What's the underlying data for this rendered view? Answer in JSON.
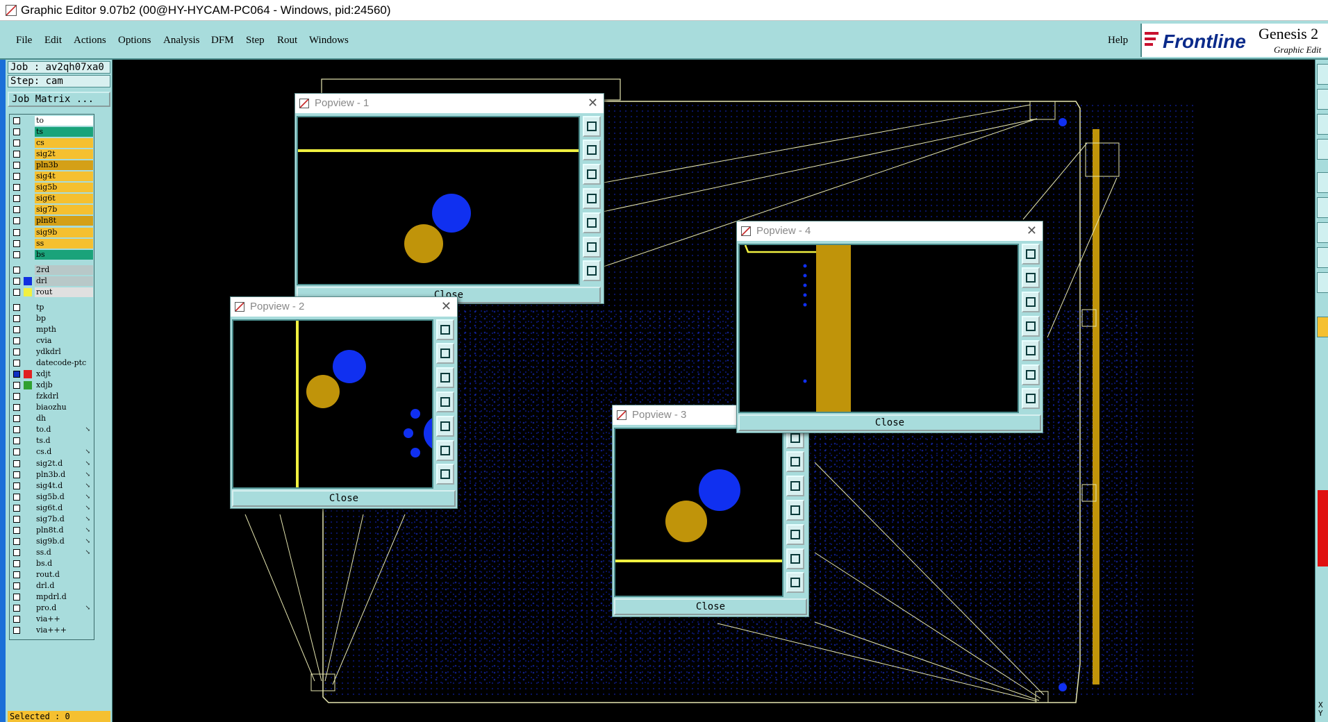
{
  "window": {
    "title": "Graphic Editor 9.07b2 (00@HY-HYCAM-PC064 - Windows, pid:24560)"
  },
  "menu": {
    "items": [
      "File",
      "Edit",
      "Actions",
      "Options",
      "Analysis",
      "DFM",
      "Step",
      "Rout",
      "Windows"
    ],
    "help": "Help"
  },
  "brand": {
    "logo": "Frontline",
    "product": "Genesis 2",
    "subtitle": "Graphic Edit"
  },
  "job": {
    "job_line": "Job : av2qh07xa0",
    "step_line": "Step: cam",
    "matrix_button": "Job Matrix ..."
  },
  "layers": [
    {
      "name": "to",
      "color": "#ffffff"
    },
    {
      "name": "ts",
      "color": "#1aa37a"
    },
    {
      "name": "cs",
      "color": "#f5c030"
    },
    {
      "name": "sig2t",
      "color": "#f5c030"
    },
    {
      "name": "pln3b",
      "color": "#d4a017"
    },
    {
      "name": "sig4t",
      "color": "#f5c030"
    },
    {
      "name": "sig5b",
      "color": "#f5c030"
    },
    {
      "name": "sig6t",
      "color": "#f5c030"
    },
    {
      "name": "sig7b",
      "color": "#f5c030"
    },
    {
      "name": "pln8t",
      "color": "#d4a017"
    },
    {
      "name": "sig9b",
      "color": "#f5c030"
    },
    {
      "name": "ss",
      "color": "#f5c030"
    },
    {
      "name": "bs",
      "color": "#1aa37a"
    },
    {
      "name": "2rd",
      "color": "#b8c8c8"
    },
    {
      "name": "drl",
      "color": "#b8c8c8",
      "swatch": "#1030e0"
    },
    {
      "name": "rout",
      "color": "#e0e0e0",
      "swatch": "#f0f040"
    },
    {
      "name": "tp",
      "color": "#a8dcdc"
    },
    {
      "name": "bp",
      "color": "#a8dcdc"
    },
    {
      "name": "mpth",
      "color": "#a8dcdc"
    },
    {
      "name": "cvia",
      "color": "#a8dcdc"
    },
    {
      "name": "ydkdrl",
      "color": "#a8dcdc"
    },
    {
      "name": "datecode-ptc",
      "color": "#a8dcdc"
    },
    {
      "name": "xdjt",
      "color": "#a8dcdc",
      "swatch": "#e02020",
      "checked": true
    },
    {
      "name": "xdjb",
      "color": "#a8dcdc",
      "swatch": "#30a030"
    },
    {
      "name": "fzkdrl",
      "color": "#a8dcdc"
    },
    {
      "name": "biaozhu",
      "color": "#a8dcdc"
    },
    {
      "name": "dh",
      "color": "#a8dcdc"
    },
    {
      "name": "to.d",
      "color": "#a8dcdc",
      "mark": "↘"
    },
    {
      "name": "ts.d",
      "color": "#a8dcdc"
    },
    {
      "name": "cs.d",
      "color": "#a8dcdc",
      "mark": "↘"
    },
    {
      "name": "sig2t.d",
      "color": "#a8dcdc",
      "mark": "↘"
    },
    {
      "name": "pln3b.d",
      "color": "#a8dcdc",
      "mark": "↘"
    },
    {
      "name": "sig4t.d",
      "color": "#a8dcdc",
      "mark": "↘"
    },
    {
      "name": "sig5b.d",
      "color": "#a8dcdc",
      "mark": "↘"
    },
    {
      "name": "sig6t.d",
      "color": "#a8dcdc",
      "mark": "↘"
    },
    {
      "name": "sig7b.d",
      "color": "#a8dcdc",
      "mark": "↘"
    },
    {
      "name": "pln8t.d",
      "color": "#a8dcdc",
      "mark": "↘"
    },
    {
      "name": "sig9b.d",
      "color": "#a8dcdc",
      "mark": "↘"
    },
    {
      "name": "ss.d",
      "color": "#a8dcdc",
      "mark": "↘"
    },
    {
      "name": "bs.d",
      "color": "#a8dcdc"
    },
    {
      "name": "rout.d",
      "color": "#a8dcdc"
    },
    {
      "name": "drl.d",
      "color": "#a8dcdc"
    },
    {
      "name": "mpdrl.d",
      "color": "#a8dcdc"
    },
    {
      "name": "pro.d",
      "color": "#a8dcdc",
      "mark": "↘"
    },
    {
      "name": "via++",
      "color": "#a8dcdc"
    },
    {
      "name": "via+++",
      "color": "#a8dcdc"
    }
  ],
  "status": {
    "selected": "Selected : 0"
  },
  "popups": [
    {
      "title": "Popview - 1",
      "close": "Close"
    },
    {
      "title": "Popview - 2",
      "close": "Close"
    },
    {
      "title": "Popview - 3",
      "close": "Close"
    },
    {
      "title": "Popview - 4",
      "close": "Close"
    }
  ],
  "colors": {
    "panel": "#a8dcdc",
    "board_dots": "#1428c8",
    "trace": "#f0f040",
    "pad_gold": "#c0940a",
    "via_blue": "#1030f0"
  },
  "right_ruler": [
    "X",
    "Y"
  ]
}
